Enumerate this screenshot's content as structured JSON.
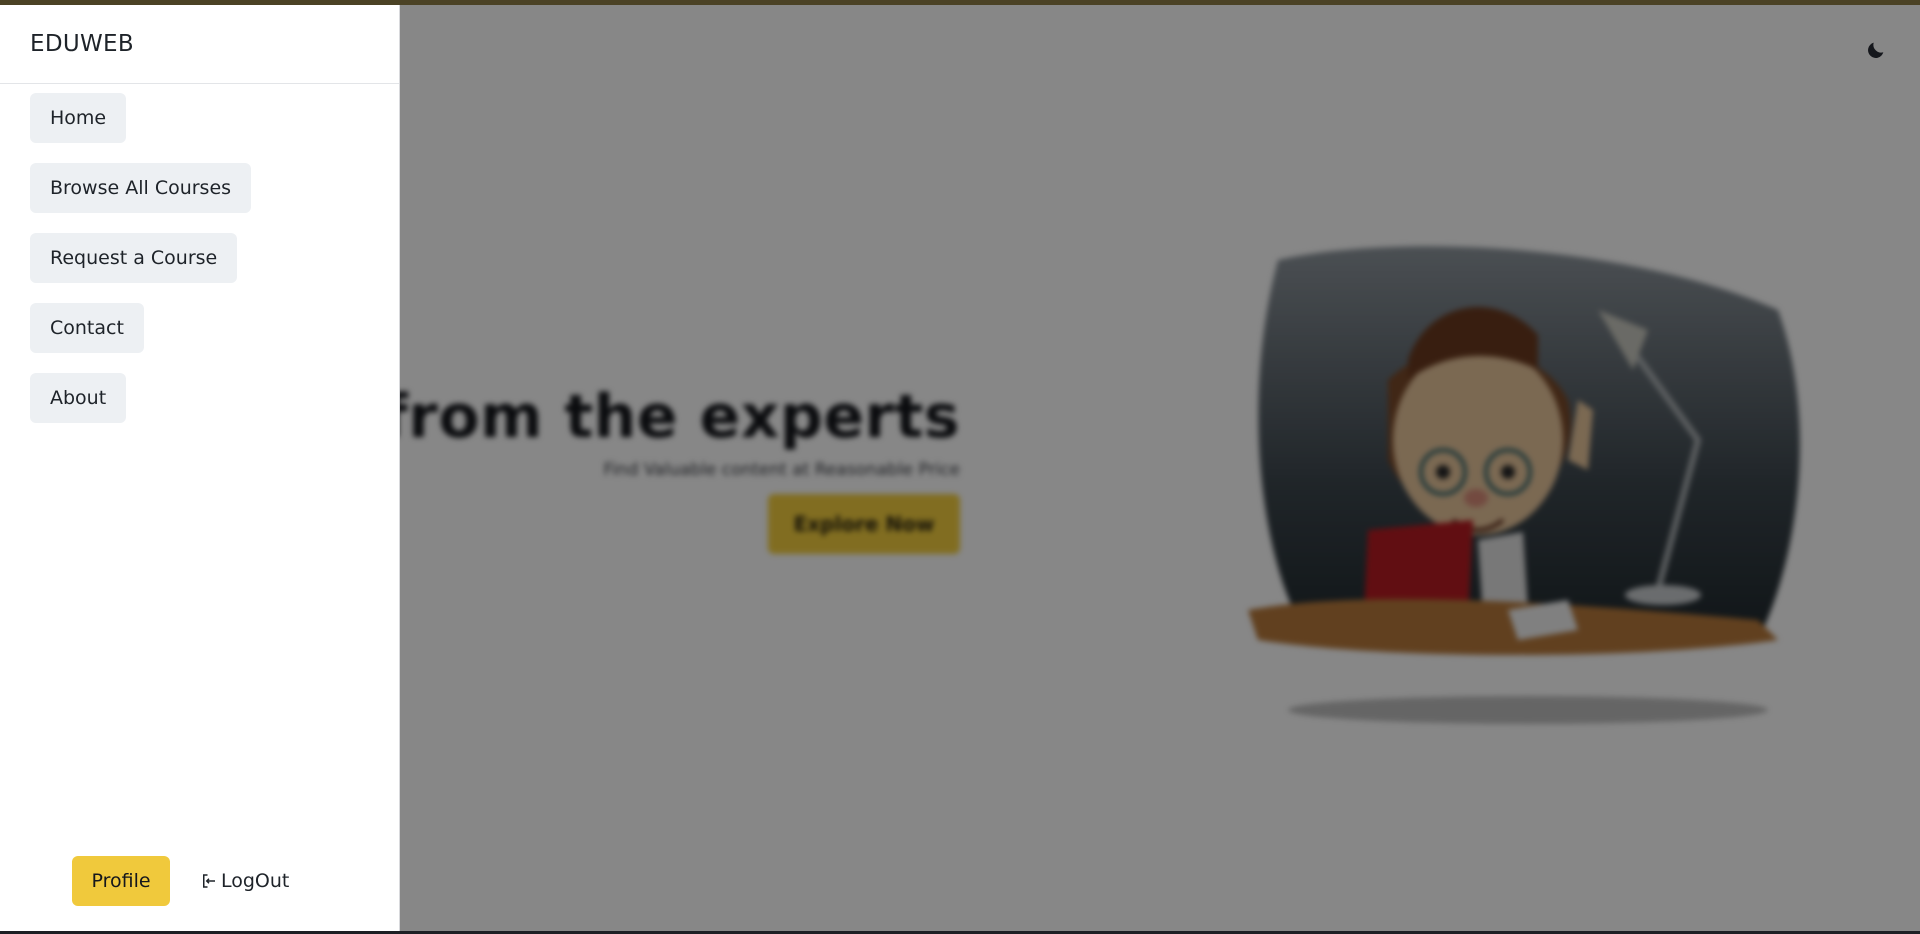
{
  "drawer": {
    "brand": "EDUWEB",
    "nav_items": [
      {
        "label": "Home"
      },
      {
        "label": "Browse All Courses"
      },
      {
        "label": "Request a Course"
      },
      {
        "label": "Contact"
      },
      {
        "label": "About"
      }
    ],
    "profile_label": "Profile",
    "logout_label": "LogOut",
    "logout_icon": "logout-icon"
  },
  "hero": {
    "title": "Learn from the experts",
    "subtitle": "Find Valuable content at Reasonable Price",
    "cta_label": "Explore Now",
    "illustration": "cartoon-reader-illustration"
  },
  "header": {
    "theme_toggle_icon": "moon-icon"
  },
  "colors": {
    "accent": "#f0c93c",
    "nav_item_bg": "#edf0f3",
    "overlay": "rgba(0,0,0,0.47)",
    "text": "#1e2329"
  }
}
